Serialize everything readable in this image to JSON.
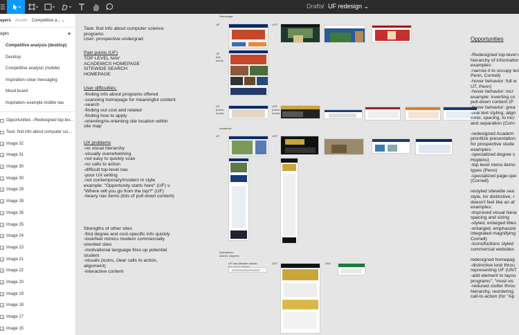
{
  "topbar": {
    "breadcrumb_folder": "Drafts",
    "breadcrumb_sep": "/",
    "file_name": "UF redesign ⌄",
    "bg_color": "#2c2c2c",
    "accent_color": "#0d99ff"
  },
  "sidebar": {
    "tabs": [
      "ayers",
      "Assets",
      "Competitive a... ⌄"
    ],
    "pages_title": "ages",
    "add_icon": "+",
    "pages": [
      "Competitive analysis (desktop)",
      "Desktop",
      "Competitive analysis (mobile)",
      "Inspiration–clear messaging",
      "Mood board",
      "Inspiration–example mobile nav"
    ],
    "layers": [
      "Opportunities –Redesigned top-lev...",
      "Task: find info about computer sci...",
      "Image 32",
      "Image 31",
      "Image 30",
      "Image 30",
      "Image 29",
      "Image 28",
      "Image 26",
      "Image 25",
      "Image 24",
      "Image 23",
      "Image 21",
      "Image 22",
      "Image 20",
      "Image 19",
      "Image 18",
      "Image 17",
      "Image 15"
    ]
  },
  "notes": {
    "task": "Task: find info about computer science\nprograms\nUser: prospective undergrad",
    "pain_title": "Pain points (UF)",
    "pain": "TOP LEVEL NAV\nACADEMICS HOMEPAGE\nSITEWIDE SEARCH\nHOMEPAGE",
    "diff_title": "User difficulties:",
    "diff": "-finding info about programs offered\n-scanning homepage for meaningful content\n-search\n-finding out cost and related\n-finding how to apply\n-orienting/re-orienting site location within\nsite map",
    "ux_title": "UX problems",
    "ux": "-no visual hierarchy\n-visually overwhelming\n-not easy to quickly scan\n-no calls to action\n-difficult top-level nav\n-poor UX writing\n-not contemporary/modern in style\nexample: \"Opportunity starts here\" (UF) v.\n\"Where will you go from the top?\" (UF)\n-heavy nav items (lots of pull down content)",
    "str": "Strengths of other sites\n-find degree and cost-specific info quickly\n-look/feel mimics modern commercially\noriented sites\n-motivational language fires up potential\nstudent\n-visuals (icons, clear calls to action,\nalignment)\n-interactive content"
  },
  "labels": {
    "homepage": "Homepage",
    "academic": "Academic",
    "specialized": "Specialized\nsearch, degrees",
    "uf": "UF",
    "ucf": "UCF",
    "uf_full": "UF\n(full\nscroll)",
    "uf_menu": "UF\n(menu\nhover)",
    "ucf_menu": "UCF\n(menu\nhover)",
    "unt": "UNT",
    "uf_search_note": "UF has sitewide search,\nbut not by degree"
  },
  "opportunities": {
    "title": "Opportunities",
    "body": "-Redesigned top-level nav\nhierarchy of information\nexamples:\n-narrow it to occupy less\nPenn, Cornell)\n-hover behavior: full w\nUT, Penn)\n-hover behavior: incr\nexample: inverting co\npull-down content (P\n-hover behavior: grea\n-use text styling, align\ncolor, spacing, to incr\nand separation (Corn\n\n-redesigned Academ\nprioritize presentation\nfor prospective stude\nexamples:\n-specialized degree s\nHopkins)\n-top level menu items\ntypes (Penn)\n-specialized page-spe\n(Cornell)\n\nrestyled sitewide sea\nstyle, for distinctive, r\ndoesn't feel like an af\nexamples:\n-improved visual hiera\nspacing and sizing\n-styled, enlarged titles\n-enlarged, emphasize\nintegrated magnifying\nCornell)\n-icons/buttons styled\ncommercial websites\n\nredesigned homepag\n-distinctive look throu\nrepresenting UF (UNT\n-add element to layou\nprograms\", \"most vis\n-reduced clutter throu\nhierarchy, reordering\ncall-to-action (for \"Ap"
  }
}
